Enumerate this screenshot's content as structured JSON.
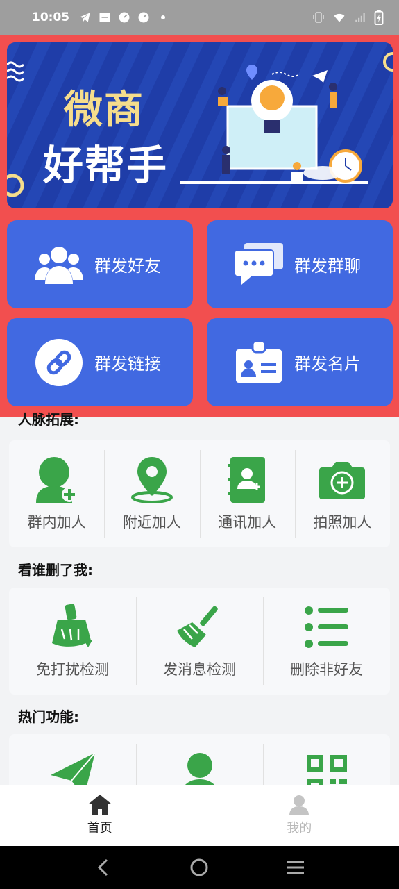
{
  "status_bar": {
    "time": "10:05"
  },
  "banner": {
    "title_line1": "微商",
    "title_line2": "好帮手"
  },
  "main_actions": [
    {
      "label": "群发好友",
      "icon": "group-icon"
    },
    {
      "label": "群发群聊",
      "icon": "chat-bubbles-icon"
    },
    {
      "label": "群发链接",
      "icon": "link-icon"
    },
    {
      "label": "群发名片",
      "icon": "id-card-icon"
    }
  ],
  "sections": {
    "contacts": {
      "title": "人脉拓展:",
      "items": [
        {
          "label": "群内加人",
          "icon": "add-person-icon"
        },
        {
          "label": "附近加人",
          "icon": "location-pin-icon"
        },
        {
          "label": "通讯加人",
          "icon": "contact-book-icon"
        },
        {
          "label": "拍照加人",
          "icon": "camera-add-icon"
        }
      ]
    },
    "deleted": {
      "title": "看谁删了我:",
      "items": [
        {
          "label": "免打扰检测",
          "icon": "broom-icon"
        },
        {
          "label": "发消息检测",
          "icon": "sweep-icon"
        },
        {
          "label": "删除非好友",
          "icon": "list-icon"
        }
      ]
    },
    "hot": {
      "title": "热门功能:",
      "items": [
        {
          "icon": "paper-plane-icon"
        },
        {
          "icon": "person-icon"
        },
        {
          "icon": "qr-code-icon"
        }
      ]
    }
  },
  "tabbar": {
    "home": "首页",
    "mine": "我的"
  },
  "colors": {
    "red_panel": "#f24f4f",
    "tile_blue": "#4169e1",
    "green": "#3aa549",
    "banner_blue": "#1f3da8"
  }
}
